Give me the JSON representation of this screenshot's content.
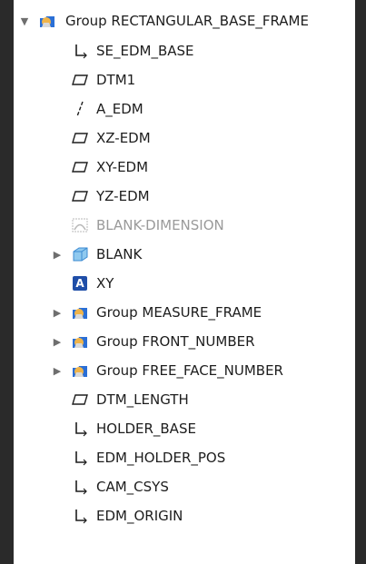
{
  "tree": {
    "items": [
      {
        "label": "Group RECTANGULAR_BASE_FRAME",
        "icon": "group-folder-icon",
        "expander": "▼"
      },
      {
        "label": "SE_EDM_BASE",
        "icon": "coordinate-system-icon"
      },
      {
        "label": "DTM1",
        "icon": "datum-plane-icon"
      },
      {
        "label": "A_EDM",
        "icon": "datum-axis-icon"
      },
      {
        "label": "XZ-EDM",
        "icon": "datum-plane-icon"
      },
      {
        "label": "XY-EDM",
        "icon": "datum-plane-icon"
      },
      {
        "label": "YZ-EDM",
        "icon": "datum-plane-icon"
      },
      {
        "label": "BLANK-DIMENSION",
        "icon": "inactive-feature-icon"
      },
      {
        "label": "BLANK",
        "icon": "part-icon",
        "expander": "▶"
      },
      {
        "label": "XY",
        "icon": "annotation-a-icon"
      },
      {
        "label": "Group MEASURE_FRAME",
        "icon": "group-folder-icon",
        "expander": "▶"
      },
      {
        "label": "Group FRONT_NUMBER",
        "icon": "group-folder-icon",
        "expander": "▶"
      },
      {
        "label": "Group FREE_FACE_NUMBER",
        "icon": "group-folder-icon",
        "expander": "▶"
      },
      {
        "label": "DTM_LENGTH",
        "icon": "datum-plane-icon"
      },
      {
        "label": "HOLDER_BASE",
        "icon": "coordinate-system-icon"
      },
      {
        "label": "EDM_HOLDER_POS",
        "icon": "coordinate-system-icon"
      },
      {
        "label": "CAM_CSYS",
        "icon": "coordinate-system-icon"
      },
      {
        "label": "EDM_ORIGIN",
        "icon": "coordinate-system-icon"
      }
    ]
  },
  "colors": {
    "background": "#2a2a2a",
    "panel": "#ffffff",
    "group_icon": "#2a6fd6",
    "group_shape": "#f0b44a",
    "dim_text": "#9a9a9a"
  }
}
